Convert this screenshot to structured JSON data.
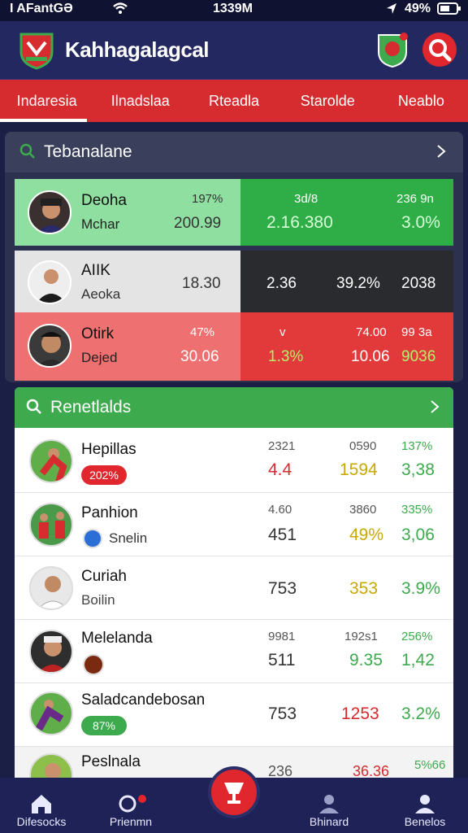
{
  "status": {
    "carrier": "I AFantGƏ",
    "time": "1339M",
    "battery": "49%"
  },
  "header": {
    "title": "Kahhagalagcal"
  },
  "tabs": [
    "Indaresia",
    "Ilnadslaa",
    "Rteadla",
    "Starolde",
    "Neablo"
  ],
  "section1": {
    "title": "Tebanalane",
    "rows": [
      {
        "name": "Deoha",
        "sub": "Mchar",
        "v1": "197%",
        "v2": "200.99",
        "v3": "3d/8",
        "v4": "2.16.380",
        "v5": "236 9n",
        "v6": "3.0%"
      },
      {
        "name": "AIIK",
        "sub": "Aeoka",
        "v2": "18.30",
        "v3": "2.36",
        "v4": "39.2%",
        "v5": "2038"
      },
      {
        "name": "Otirk",
        "sub": "Dejed",
        "v1": "47%",
        "v2": "30.06",
        "v3": "v",
        "v4": "1.3%",
        "v5": "74.00",
        "v6": "10.06",
        "v7": "99 3a",
        "v8": "9036"
      }
    ]
  },
  "section2": {
    "title": "Renetlalds",
    "rows": [
      {
        "name": "Hepillas",
        "badge": "202%",
        "c1top": "2321",
        "c1": "4.4",
        "c2top": "0590",
        "c2": "1594",
        "c3top": "137%",
        "c3": "3,38"
      },
      {
        "name": "Panhion",
        "sub": "Snelin",
        "c1top": "4.60",
        "c1": "451",
        "c2top": "3860",
        "c2": "49%",
        "c3top": "335%",
        "c3": "3,06"
      },
      {
        "name": "Curiah",
        "sub": "Boilin",
        "c1": "753",
        "c2": "353",
        "c3": "3.9%"
      },
      {
        "name": "Melelanda",
        "c1top": "9981",
        "c1": "511",
        "c2top": "192s1",
        "c2": "9.35",
        "c3top": "256%",
        "c3": "1,42"
      },
      {
        "name": "Saladcandebosan",
        "badge": "87%",
        "c1": "753",
        "c2": "1253",
        "c3": "3.2%"
      },
      {
        "name": "Peslnala",
        "c1": "236",
        "c2": "36.36",
        "c3": "5%66"
      }
    ]
  },
  "nav": [
    "Difesocks",
    "Prienmn",
    "",
    "Bhinard",
    "Benelos"
  ],
  "colors": {
    "accent": "#e0272e",
    "green": "#3daa4e",
    "navy": "#232861"
  }
}
